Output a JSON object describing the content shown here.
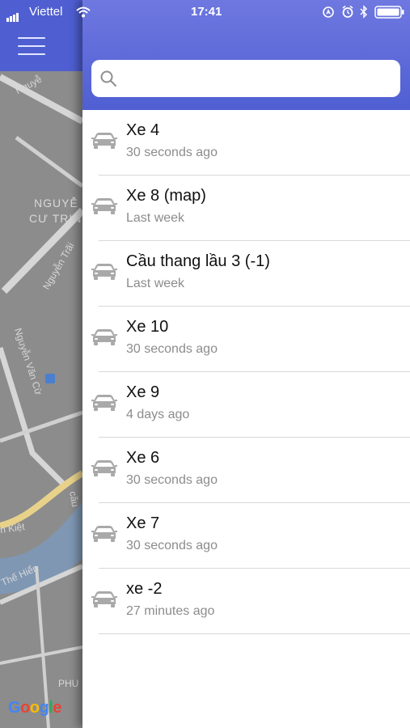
{
  "status_bar": {
    "carrier": "Viettel",
    "time": "17:41"
  },
  "map": {
    "labels": [
      "Nguyễ",
      "NGUYỄ",
      "CƯ TRIN",
      "Nguyễn Trãi",
      "Nguyễn Văn Cừ",
      "n Kiệt",
      "Thế Hiển",
      "cầu",
      "PHU"
    ],
    "attribution": "Google"
  },
  "drawer": {
    "search": {
      "placeholder": ""
    },
    "vehicles": [
      {
        "name": "Xe 4",
        "time": "30 seconds ago"
      },
      {
        "name": "Xe 8 (map)",
        "time": "Last week"
      },
      {
        "name": "Cầu thang lầu 3 (-1)",
        "time": "Last week"
      },
      {
        "name": "Xe 10",
        "time": "30 seconds ago"
      },
      {
        "name": "Xe 9",
        "time": "4 days ago"
      },
      {
        "name": "Xe 6",
        "time": "30 seconds ago"
      },
      {
        "name": "Xe 7",
        "time": "30 seconds ago"
      },
      {
        "name": "xe -2",
        "time": "27 minutes ago"
      }
    ]
  },
  "icons": {
    "menu": "hamburger-menu-icon",
    "search": "search-icon",
    "vehicle": "car-icon",
    "wifi": "wifi-icon",
    "battery": "battery-icon",
    "bluetooth": "bluetooth-icon",
    "alarm": "alarm-icon",
    "location": "location-lock-icon"
  },
  "colors": {
    "header": "#4f5fd2",
    "map": "#8c8c8c",
    "road": "#dcdcdc",
    "river": "#7f97b3"
  }
}
